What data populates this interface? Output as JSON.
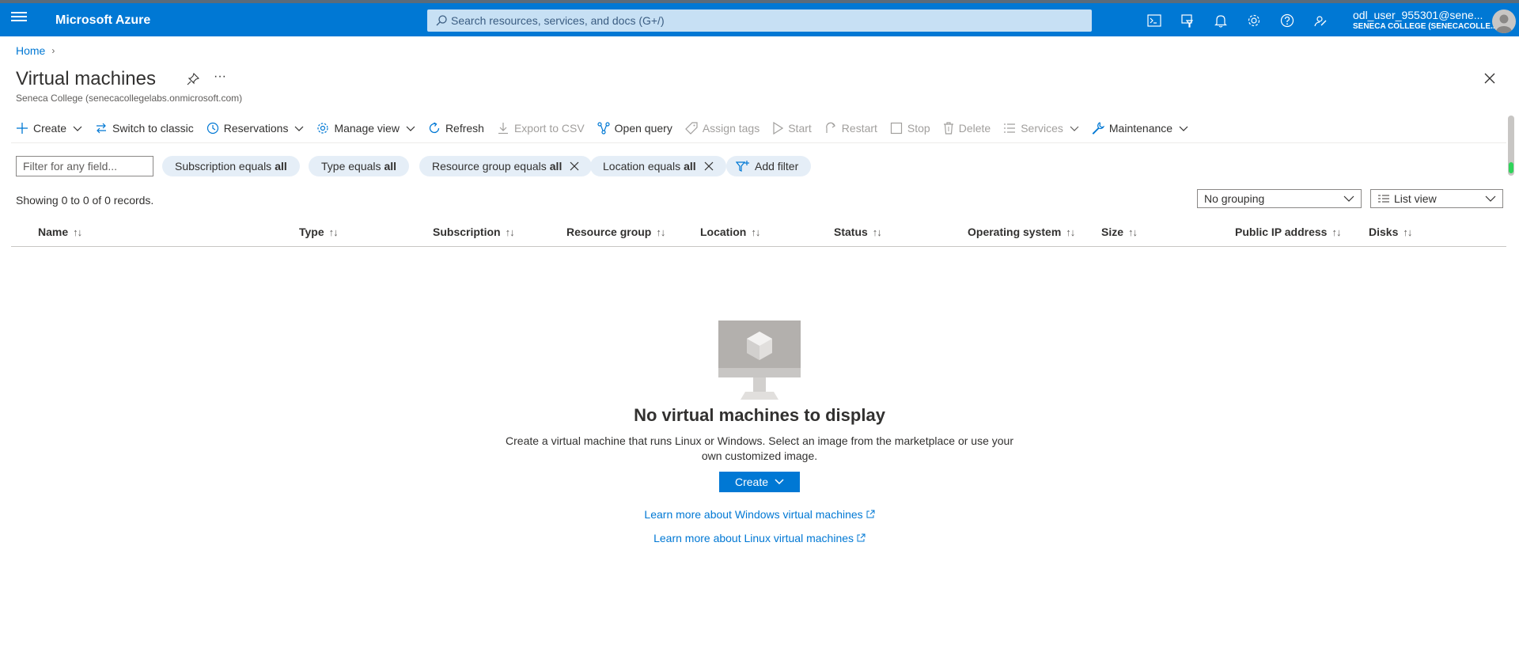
{
  "topbar": {
    "brand": "Microsoft Azure",
    "search_placeholder": "Search resources, services, and docs (G+/)",
    "user_name": "odl_user_955301@sene...",
    "user_org": "SENECA COLLEGE (SENECACOLLE..."
  },
  "breadcrumb": {
    "home": "Home"
  },
  "page": {
    "title": "Virtual machines",
    "subtitle": "Seneca College (senecacollegelabs.onmicrosoft.com)",
    "more": "···"
  },
  "toolbar": {
    "create": "Create",
    "switch_classic": "Switch to classic",
    "reservations": "Reservations",
    "manage_view": "Manage view",
    "refresh": "Refresh",
    "export_csv": "Export to CSV",
    "open_query": "Open query",
    "assign_tags": "Assign tags",
    "start": "Start",
    "restart": "Restart",
    "stop": "Stop",
    "delete": "Delete",
    "services": "Services",
    "maintenance": "Maintenance"
  },
  "filters": {
    "placeholder": "Filter for any field...",
    "subscription_label": "Subscription equals",
    "subscription_value": "all",
    "type_label": "Type equals",
    "type_value": "all",
    "resource_group_label": "Resource group equals",
    "resource_group_value": "all",
    "location_label": "Location equals",
    "location_value": "all",
    "add_filter": "Add filter"
  },
  "records_text": "Showing 0 to 0 of 0 records.",
  "grouping": "No grouping",
  "view": "List view",
  "columns": [
    "Name",
    "Type",
    "Subscription",
    "Resource group",
    "Location",
    "Status",
    "Operating system",
    "Size",
    "Public IP address",
    "Disks"
  ],
  "sort_glyph": "↑↓",
  "empty_state": {
    "title": "No virtual machines to display",
    "description": "Create a virtual machine that runs Linux or Windows. Select an image from the marketplace or use your own customized image.",
    "create_button": "Create",
    "learn_windows": "Learn more about Windows virtual machines",
    "learn_linux": "Learn more about Linux virtual machines"
  },
  "colors": {
    "topbar": "#0078d4",
    "search": "#c7e0f4",
    "pill": "#e5eef7",
    "link": "#0078d4"
  }
}
